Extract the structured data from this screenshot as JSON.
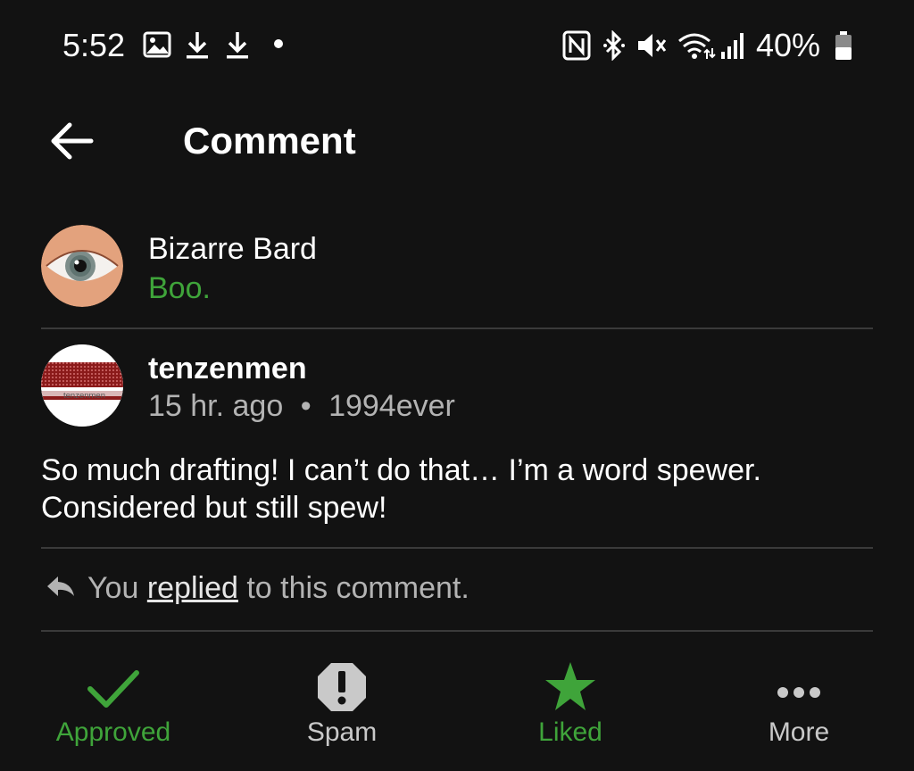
{
  "status_bar": {
    "time": "5:52",
    "battery": "40%",
    "left_icons": [
      "image-icon",
      "download-icon",
      "download-icon",
      "dot-icon"
    ],
    "right_icons": [
      "nfc-icon",
      "bluetooth-icon",
      "mute-icon",
      "wifi-icon",
      "signal-icon",
      "battery-icon"
    ]
  },
  "app_bar": {
    "title": "Comment",
    "back_icon": "arrow-left-icon"
  },
  "parent_comment": {
    "author": "Bizarre Bard",
    "text": "Boo."
  },
  "comment": {
    "author": "tenzenmen",
    "avatar_label": "tenzenmen",
    "time": "15 hr. ago",
    "separator": "•",
    "site": "1994ever",
    "body": "So much drafting!  I can’t do that… I’m a word spewer. Considered but still spew!"
  },
  "reply_note": {
    "prefix": "You ",
    "link": "replied",
    "suffix": " to this comment."
  },
  "actions": [
    {
      "label": "Approved",
      "icon": "check-icon",
      "color": "#3fa43a"
    },
    {
      "label": "Spam",
      "icon": "spam-octagon-icon",
      "color": "#c9c9c9"
    },
    {
      "label": "Liked",
      "icon": "star-icon",
      "color": "#3fa43a"
    },
    {
      "label": "More",
      "icon": "more-dots-icon",
      "color": "#c9c9c9"
    }
  ],
  "colors": {
    "background": "#121212",
    "accent_green": "#3fa43a",
    "muted_text": "#b3b3b3",
    "divider": "#3a3a3a"
  }
}
